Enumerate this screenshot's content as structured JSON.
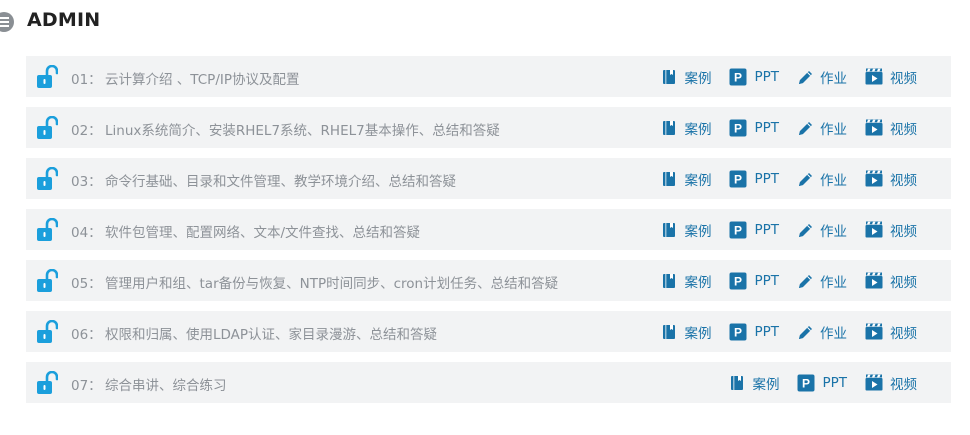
{
  "section": {
    "title": "ADMIN"
  },
  "colors": {
    "accent": "#1a73a8",
    "lock": "#1b9fdc",
    "row_bg": "#f2f3f4",
    "muted_text": "#8d9298"
  },
  "lessons": [
    {
      "num": "01：",
      "title": "云计算介绍 、TCP/IP协议及配置",
      "actions": [
        {
          "label": "案例",
          "icon": "case-icon"
        },
        {
          "label": "PPT",
          "icon": "ppt-icon"
        },
        {
          "label": "作业",
          "icon": "homework-icon"
        },
        {
          "label": "视频",
          "icon": "video-icon"
        }
      ]
    },
    {
      "num": "02：",
      "title": "Linux系统简介、安装RHEL7系统、RHEL7基本操作、总结和答疑",
      "actions": [
        {
          "label": "案例",
          "icon": "case-icon"
        },
        {
          "label": "PPT",
          "icon": "ppt-icon"
        },
        {
          "label": "作业",
          "icon": "homework-icon"
        },
        {
          "label": "视频",
          "icon": "video-icon"
        }
      ]
    },
    {
      "num": "03：",
      "title": "命令行基础、目录和文件管理、教学环境介绍、总结和答疑",
      "actions": [
        {
          "label": "案例",
          "icon": "case-icon"
        },
        {
          "label": "PPT",
          "icon": "ppt-icon"
        },
        {
          "label": "作业",
          "icon": "homework-icon"
        },
        {
          "label": "视频",
          "icon": "video-icon"
        }
      ]
    },
    {
      "num": "04：",
      "title": "软件包管理、配置网络、文本/文件查找、总结和答疑",
      "actions": [
        {
          "label": "案例",
          "icon": "case-icon"
        },
        {
          "label": "PPT",
          "icon": "ppt-icon"
        },
        {
          "label": "作业",
          "icon": "homework-icon"
        },
        {
          "label": "视频",
          "icon": "video-icon"
        }
      ]
    },
    {
      "num": "05：",
      "title": "管理用户和组、tar备份与恢复、NTP时间同步、cron计划任务、总结和答疑",
      "actions": [
        {
          "label": "案例",
          "icon": "case-icon"
        },
        {
          "label": "PPT",
          "icon": "ppt-icon"
        },
        {
          "label": "作业",
          "icon": "homework-icon"
        },
        {
          "label": "视频",
          "icon": "video-icon"
        }
      ]
    },
    {
      "num": "06：",
      "title": "权限和归属、使用LDAP认证、家目录漫游、总结和答疑",
      "actions": [
        {
          "label": "案例",
          "icon": "case-icon"
        },
        {
          "label": "PPT",
          "icon": "ppt-icon"
        },
        {
          "label": "作业",
          "icon": "homework-icon"
        },
        {
          "label": "视频",
          "icon": "video-icon"
        }
      ]
    },
    {
      "num": "07：",
      "title": "综合串讲、综合练习",
      "actions": [
        {
          "label": "案例",
          "icon": "case-icon"
        },
        {
          "label": "PPT",
          "icon": "ppt-icon"
        },
        {
          "label": "视频",
          "icon": "video-icon"
        }
      ]
    }
  ]
}
